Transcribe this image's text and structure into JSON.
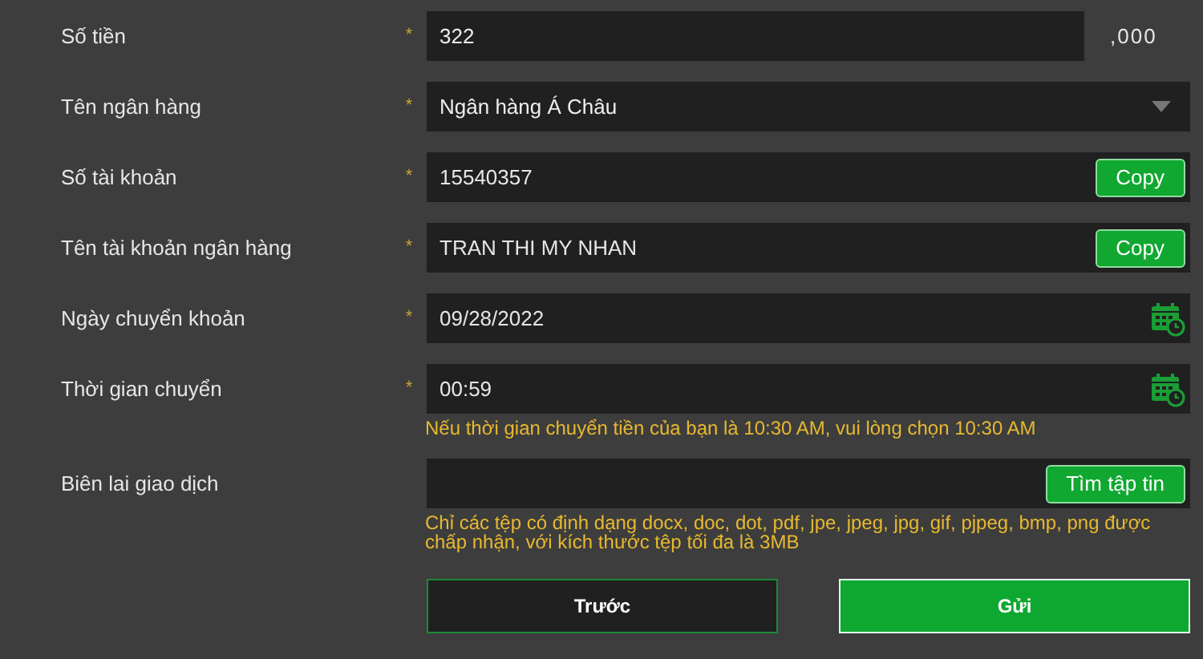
{
  "fields": [
    {
      "kind": "amount",
      "label": "Số tiền",
      "required_mark": "*",
      "value": "322",
      "suffix": ",000"
    },
    {
      "kind": "select",
      "label": "Tên ngân hàng",
      "required_mark": "*",
      "value": "Ngân hàng Á Châu"
    },
    {
      "kind": "copy",
      "label": "Số tài khoản",
      "required_mark": "*",
      "value": "15540357",
      "button": "Copy"
    },
    {
      "kind": "copy",
      "label": "Tên tài khoản ngân hàng",
      "required_mark": "*",
      "value": "TRAN THI MY NHAN",
      "button": "Copy"
    },
    {
      "kind": "date",
      "label": "Ngày chuyển khoản",
      "required_mark": "*",
      "value": "09/28/2022"
    },
    {
      "kind": "time",
      "label": "Thời gian chuyển",
      "required_mark": "*",
      "value": "00:59",
      "hint": "Nếu thời gian chuyển tiền của bạn là 10:30 AM, vui lòng chọn 10:30 AM"
    },
    {
      "kind": "file",
      "label": "Biên lai giao dịch",
      "button": "Tìm tập tin",
      "hint": "Chỉ các tệp có định dạng docx, doc, dot, pdf, jpe, jpeg, jpg, gif, pjpeg, bmp, png được chấp nhận, với kích thước tệp tối đa là 3MB"
    }
  ],
  "buttons": [
    {
      "label": "Trước",
      "kind": "secondary"
    },
    {
      "label": "Gửi",
      "kind": "primary"
    }
  ]
}
